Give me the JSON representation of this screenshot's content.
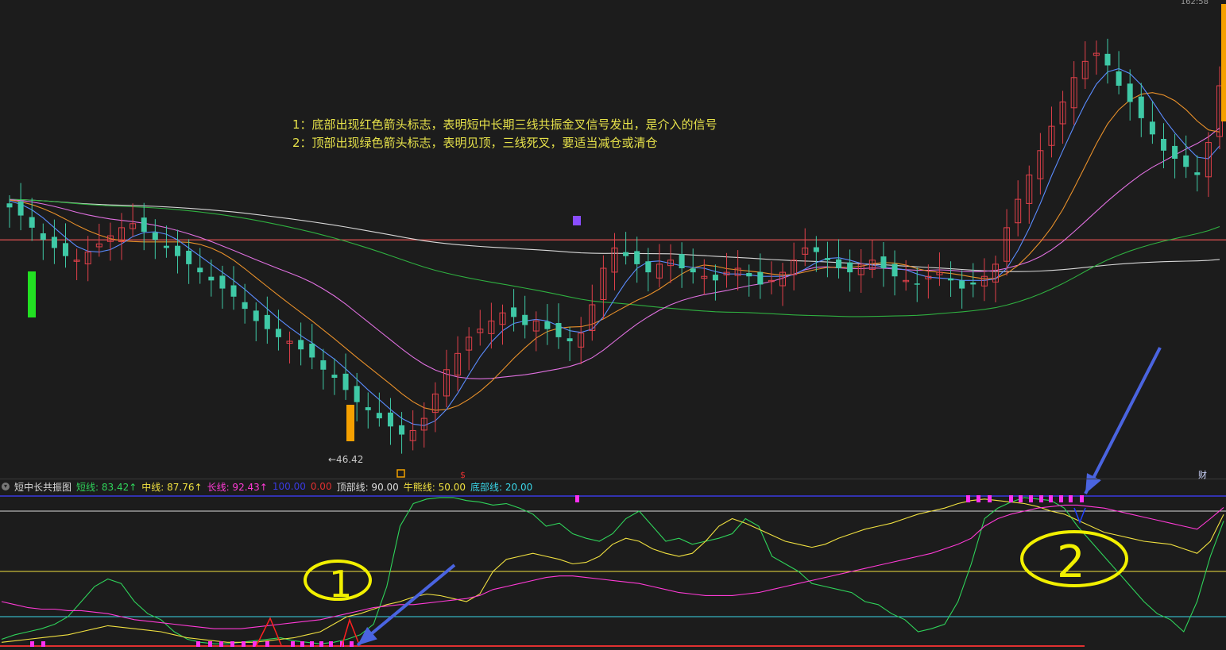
{
  "header": {
    "time_tag": "162:58"
  },
  "annotations": {
    "note1": "1：底部出现红色箭头标志，表明短中长期三线共振金叉信号发出，是介入的信号",
    "note2": "2：顶部出现绿色箭头标志，表明见顶，三线死叉，要适当减仓或清仓",
    "low_price": "←46.42",
    "cai": "财",
    "circle1": "1",
    "circle2": "2"
  },
  "indicator": {
    "name": "短中长共振图",
    "items": [
      {
        "label": "短线: 83.42↑",
        "color": "#2fd35a"
      },
      {
        "label": "中线: 87.76↑",
        "color": "#f0e040"
      },
      {
        "label": "长线: 92.43↑",
        "color": "#ff3ad6"
      },
      {
        "label": "100.00",
        "color": "#3a3ae0"
      },
      {
        "label": "0.00",
        "color": "#e03030"
      },
      {
        "label": "顶部线: 90.00",
        "color": "#dcdcdc"
      },
      {
        "label": "牛熊线: 50.00",
        "color": "#f0e040"
      },
      {
        "label": "底部线: 20.00",
        "color": "#3ad6e8"
      }
    ]
  },
  "colors": {
    "up": "#e0404a",
    "down": "#3fc9a6",
    "ma5": "#5b8cff",
    "ma10": "#e8902a",
    "ma20": "#e070e0",
    "ma60": "#2fb040",
    "ma120": "#d8d8d8",
    "flat": "#e05050",
    "arrow": "#4a64e0",
    "circle": "#f2f000"
  },
  "chart_data": [
    {
      "type": "candlestick",
      "low_marker": 46.42,
      "candles_note": "approximate normalized closes (0=low 46.42, 100=high)",
      "closes": [
        60,
        58,
        55,
        52,
        50,
        48,
        47,
        49,
        51,
        53,
        55,
        56,
        54,
        52,
        50,
        48,
        46,
        44,
        42,
        40,
        38,
        35,
        32,
        30,
        28,
        27,
        25,
        23,
        20,
        18,
        15,
        12,
        10,
        8,
        6,
        4,
        5,
        8,
        14,
        20,
        24,
        28,
        30,
        32,
        34,
        33,
        31,
        32,
        30,
        28,
        27,
        29,
        36,
        45,
        50,
        48,
        46,
        44,
        46,
        47,
        45,
        44,
        43,
        42,
        44,
        45,
        43,
        41,
        42,
        44,
        47,
        50,
        49,
        47,
        45,
        44,
        46,
        47,
        45,
        43,
        42,
        41,
        43,
        44,
        42,
        40,
        41,
        43,
        46,
        55,
        62,
        68,
        74,
        80,
        86,
        92,
        96,
        98,
        95,
        90,
        86,
        82,
        78,
        74,
        72,
        70,
        68,
        76,
        90
      ]
    },
    {
      "type": "line",
      "title": "短中长共振图",
      "ylim": [
        0,
        100
      ],
      "reference_lines": {
        "顶部线": 90,
        "牛熊线": 50,
        "底部线": 20,
        "top": 100,
        "bottom": 0
      },
      "series": [
        {
          "name": "短线",
          "values": [
            5,
            8,
            10,
            12,
            15,
            20,
            30,
            40,
            45,
            42,
            30,
            22,
            18,
            10,
            5,
            3,
            2,
            2,
            3,
            4,
            5,
            6,
            4,
            3,
            2,
            3,
            5,
            8,
            15,
            40,
            80,
            95,
            98,
            99,
            99,
            97,
            96,
            94,
            95,
            92,
            88,
            80,
            82,
            75,
            72,
            70,
            75,
            85,
            90,
            80,
            70,
            72,
            68,
            70,
            72,
            75,
            85,
            80,
            60,
            55,
            50,
            42,
            40,
            38,
            36,
            30,
            28,
            22,
            18,
            10,
            12,
            15,
            30,
            55,
            85,
            92,
            96,
            99,
            98,
            97,
            92,
            80,
            70,
            60,
            50,
            40,
            30,
            22,
            18,
            10,
            30,
            60,
            83.42
          ]
        },
        {
          "name": "中线",
          "values": [
            3,
            4,
            5,
            6,
            7,
            8,
            10,
            12,
            14,
            13,
            12,
            11,
            10,
            8,
            6,
            5,
            4,
            3,
            3,
            3,
            4,
            5,
            6,
            8,
            10,
            15,
            20,
            22,
            25,
            28,
            30,
            33,
            35,
            34,
            32,
            30,
            35,
            50,
            58,
            60,
            62,
            60,
            58,
            55,
            56,
            60,
            68,
            72,
            70,
            65,
            62,
            60,
            62,
            70,
            80,
            85,
            82,
            78,
            74,
            70,
            68,
            66,
            68,
            72,
            75,
            78,
            80,
            82,
            85,
            88,
            90,
            92,
            95,
            97,
            98,
            97,
            96,
            95,
            93,
            90,
            88,
            84,
            80,
            76,
            74,
            72,
            70,
            69,
            68,
            65,
            62,
            70,
            87.76
          ]
        },
        {
          "name": "长线",
          "values": [
            30,
            28,
            26,
            25,
            25,
            24,
            24,
            23,
            22,
            20,
            18,
            17,
            16,
            15,
            14,
            13,
            12,
            12,
            12,
            13,
            14,
            15,
            16,
            17,
            18,
            20,
            22,
            24,
            26,
            27,
            28,
            28,
            29,
            30,
            31,
            32,
            34,
            38,
            40,
            42,
            44,
            46,
            47,
            47,
            46,
            45,
            44,
            43,
            42,
            40,
            38,
            36,
            35,
            34,
            34,
            34,
            35,
            36,
            38,
            40,
            42,
            44,
            46,
            48,
            50,
            52,
            54,
            56,
            58,
            60,
            62,
            65,
            68,
            72,
            80,
            85,
            88,
            90,
            92,
            93,
            94,
            94,
            93,
            92,
            90,
            88,
            86,
            84,
            82,
            80,
            78,
            85,
            92.43
          ]
        }
      ]
    }
  ]
}
